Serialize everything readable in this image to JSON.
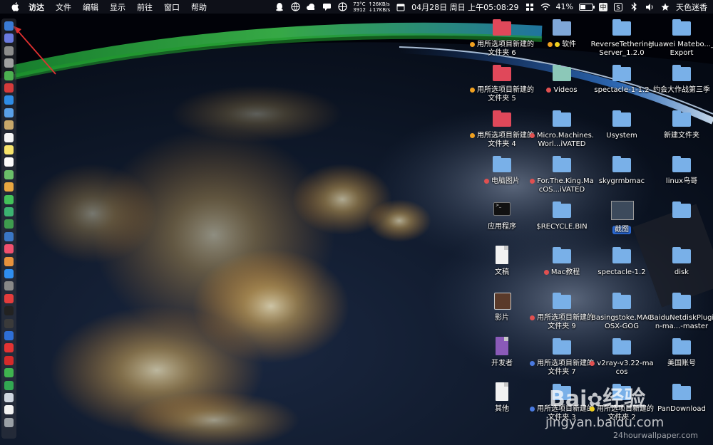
{
  "menubar": {
    "apple_icon": "apple-icon",
    "menus": [
      "访达",
      "文件",
      "编辑",
      "显示",
      "前往",
      "窗口",
      "帮助"
    ],
    "status": {
      "cpu_temp": "73°C",
      "cpu_rpm": "3912",
      "upload": "↑26KB/s",
      "download": "↓17KB/s",
      "date": "04月28日 周日 上午05:08:29",
      "battery_percent": "41%",
      "battery_level": 0.41,
      "input_method": "中",
      "user": "天色迷香"
    },
    "status_icons": [
      "qq-icon",
      "globe-icon",
      "cloud-icon",
      "chat-icon",
      "network-icon",
      "calendar-icon",
      "grid-icon",
      "wifi-icon",
      "battery-icon",
      "s-icon",
      "bluetooth-icon",
      "volume-icon",
      "star-icon"
    ]
  },
  "dock": {
    "items": [
      {
        "name": "finder",
        "color": "#3a7bd5"
      },
      {
        "name": "siri",
        "color": "#6a7ae0"
      },
      {
        "name": "launchpad",
        "color": "#8c8c8c"
      },
      {
        "name": "rocket",
        "color": "#a0a0a0"
      },
      {
        "name": "android",
        "color": "#4caf50"
      },
      {
        "name": "red-app",
        "color": "#d43b3b"
      },
      {
        "name": "safari",
        "color": "#2e8ce6"
      },
      {
        "name": "mail",
        "color": "#5aa0e8"
      },
      {
        "name": "stamp",
        "color": "#c7a76a"
      },
      {
        "name": "calendar",
        "color": "#f4f4f4"
      },
      {
        "name": "notes",
        "color": "#f6e36b"
      },
      {
        "name": "reminders",
        "color": "#fafafa"
      },
      {
        "name": "maps",
        "color": "#6abf69"
      },
      {
        "name": "photos",
        "color": "#e8a640"
      },
      {
        "name": "messages",
        "color": "#43c25a"
      },
      {
        "name": "facetime",
        "color": "#3cb371"
      },
      {
        "name": "numbers",
        "color": "#3e9c4e"
      },
      {
        "name": "keynote",
        "color": "#3a76c4"
      },
      {
        "name": "music",
        "color": "#f0506e"
      },
      {
        "name": "books",
        "color": "#e8923c"
      },
      {
        "name": "app-store",
        "color": "#2f8ef0"
      },
      {
        "name": "preferences",
        "color": "#888888"
      },
      {
        "name": "vivaldi",
        "color": "#e33c3c"
      },
      {
        "name": "terminal",
        "color": "#222222"
      },
      {
        "name": "activity",
        "color": "#3a3a3a"
      },
      {
        "name": "vpn",
        "color": "#2e6fd6"
      },
      {
        "name": "yandex",
        "color": "#e33333"
      },
      {
        "name": "netease",
        "color": "#d42a2a"
      },
      {
        "name": "wechat",
        "color": "#3fb34f"
      },
      {
        "name": "green-app",
        "color": "#32a852"
      },
      {
        "name": "airdrop",
        "color": "#cfd6e0"
      },
      {
        "name": "document",
        "color": "#f2f2f2"
      },
      {
        "name": "trash",
        "color": "#9aa0a6"
      }
    ]
  },
  "desktop": {
    "items": [
      {
        "label": "用所选项目新建的文件夹 6",
        "icon": "folder",
        "color": "#e0485a",
        "tag": "#f0a020",
        "tag2": ""
      },
      {
        "label": "软件",
        "icon": "folder",
        "color": "#7fa7d8",
        "tag": "#f0a020",
        "tag2": "#f0d020"
      },
      {
        "label": "ReverseTetheringServer_1.2.0",
        "icon": "folder",
        "color": "#79b0e8",
        "tag": "",
        "tag2": ""
      },
      {
        "label": "Huawei Matebo..._Export",
        "icon": "folder",
        "color": "#79b0e8",
        "tag": "",
        "tag2": ""
      },
      {
        "label": "用所选项目新建的文件夹 5",
        "icon": "folder",
        "color": "#e0485a",
        "tag": "#f0a020",
        "tag2": ""
      },
      {
        "label": "Videos",
        "icon": "folder",
        "color": "#8cc8b8",
        "tag": "#e05050",
        "tag2": ""
      },
      {
        "label": "spectacle-1-1.2",
        "icon": "folder",
        "color": "#79b0e8",
        "tag": "",
        "tag2": ""
      },
      {
        "label": "约会大作战第三季",
        "icon": "folder",
        "color": "#79b0e8",
        "tag": "",
        "tag2": ""
      },
      {
        "label": "用所选项目新建的文件夹 4",
        "icon": "folder",
        "color": "#e0485a",
        "tag": "#f0a020",
        "tag2": ""
      },
      {
        "label": "Micro.Machines.Worl...iVATED",
        "icon": "folder",
        "color": "#79b0e8",
        "tag": "#e05050",
        "tag2": ""
      },
      {
        "label": "Usystem",
        "icon": "folder",
        "color": "#79b0e8",
        "tag": "",
        "tag2": ""
      },
      {
        "label": "新建文件夹",
        "icon": "folder",
        "color": "#79b0e8",
        "tag": "",
        "tag2": ""
      },
      {
        "label": "电脑图片",
        "icon": "folder",
        "color": "#79b0e8",
        "tag": "#e05050",
        "tag2": ""
      },
      {
        "label": "For.The.King.MacOS...iVATED",
        "icon": "folder",
        "color": "#79b0e8",
        "tag": "#e05050",
        "tag2": ""
      },
      {
        "label": "skygrmbmac",
        "icon": "folder",
        "color": "#79b0e8",
        "tag": "",
        "tag2": ""
      },
      {
        "label": "linux鸟哥",
        "icon": "folder",
        "color": "#79b0e8",
        "tag": "",
        "tag2": ""
      },
      {
        "label": "应用程序",
        "icon": "terminal",
        "color": "#111111",
        "tag": "",
        "tag2": ""
      },
      {
        "label": "$RECYCLE.BIN",
        "icon": "folder",
        "color": "#79b0e8",
        "tag": "",
        "tag2": ""
      },
      {
        "label": "截图",
        "icon": "thumb",
        "color": "#3c4a5c",
        "tag": "",
        "tag2": ""
      },
      {
        "label": "",
        "icon": "folder",
        "color": "#79b0e8",
        "tag": "",
        "tag2": ""
      },
      {
        "label": "文稿",
        "icon": "doc",
        "color": "#f2f2f2",
        "tag": "",
        "tag2": ""
      },
      {
        "label": "Mac教程",
        "icon": "folder",
        "color": "#79b0e8",
        "tag": "#e05050",
        "tag2": ""
      },
      {
        "label": "spectacle-1.2",
        "icon": "folder",
        "color": "#79b0e8",
        "tag": "",
        "tag2": ""
      },
      {
        "label": "disk",
        "icon": "folder",
        "color": "#79b0e8",
        "tag": "",
        "tag2": ""
      },
      {
        "label": "影片",
        "icon": "movie",
        "color": "#5a3a2a",
        "tag": "",
        "tag2": ""
      },
      {
        "label": "用所选项目新建的文件夹 9",
        "icon": "folder",
        "color": "#79b0e8",
        "tag": "#e05050",
        "tag2": ""
      },
      {
        "label": "Basingstoke.MACOSX-GOG",
        "icon": "folder",
        "color": "#79b0e8",
        "tag": "",
        "tag2": ""
      },
      {
        "label": "BaiduNetdiskPlugin-ma...-master",
        "icon": "folder",
        "color": "#79b0e8",
        "tag": "",
        "tag2": ""
      },
      {
        "label": "开发者",
        "icon": "dev",
        "color": "#8a5ab8",
        "tag": "",
        "tag2": ""
      },
      {
        "label": "用所选项目新建的文件夹 7",
        "icon": "folder",
        "color": "#79b0e8",
        "tag": "#4a7ae0",
        "tag2": ""
      },
      {
        "label": "v2ray-v3.22-macos",
        "icon": "folder",
        "color": "#79b0e8",
        "tag": "#e05050",
        "tag2": ""
      },
      {
        "label": "美国账号",
        "icon": "folder",
        "color": "#79b0e8",
        "tag": "",
        "tag2": ""
      },
      {
        "label": "其他",
        "icon": "doc",
        "color": "#f2f2f2",
        "tag": "",
        "tag2": ""
      },
      {
        "label": "用所选项目新建的文件夹 3",
        "icon": "folder",
        "color": "#79b0e8",
        "tag": "#4a7ae0",
        "tag2": ""
      },
      {
        "label": "用所选项目新建的文件夹 2",
        "icon": "folder",
        "color": "#79b0e8",
        "tag": "#f0d020",
        "tag2": ""
      },
      {
        "label": "PanDownload",
        "icon": "folder",
        "color": "#79b0e8",
        "tag": "",
        "tag2": ""
      }
    ]
  },
  "watermarks": {
    "baidu": "Bai",
    "jingyan": "经验",
    "url": "jingyan.baidu.com",
    "wallpaper_site": "24hourwallpaper.com"
  },
  "colors": {
    "accent_selection": "#2b6ad6",
    "aurora": "#38d24a",
    "city_lights": "#ffcf70"
  }
}
